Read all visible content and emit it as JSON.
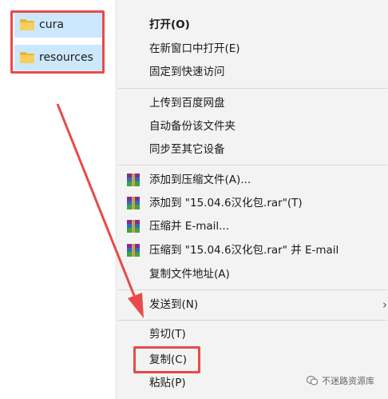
{
  "files": [
    {
      "name": "cura",
      "icon": "folder-icon"
    },
    {
      "name": "resources",
      "icon": "folder-icon"
    }
  ],
  "menu": {
    "items": [
      {
        "label": "打开(O)",
        "bold": true
      },
      {
        "label": "在新窗口中打开(E)"
      },
      {
        "label": "固定到快速访问"
      },
      {
        "label": "上传到百度网盘"
      },
      {
        "label": "自动备份该文件夹"
      },
      {
        "label": "同步至其它设备"
      },
      {
        "label": "添加到压缩文件(A)...",
        "icon": "winrar-icon"
      },
      {
        "label": "添加到 \"15.04.6汉化包.rar\"(T)",
        "icon": "winrar-icon"
      },
      {
        "label": "压缩并 E-mail...",
        "icon": "winrar-icon"
      },
      {
        "label": "压缩到 \"15.04.6汉化包.rar\" 并 E-mail",
        "icon": "winrar-icon"
      },
      {
        "label": "复制文件地址(A)"
      },
      {
        "label": "发送到(N)",
        "submenu": true
      },
      {
        "label": "剪切(T)"
      },
      {
        "label": "复制(C)"
      },
      {
        "label": "粘贴(P)"
      }
    ]
  },
  "watermark": {
    "text": "不迷路资源库"
  },
  "colors": {
    "highlight": "#e84a4a",
    "selection": "#cce8ff",
    "menu_bg": "#f3f3f3",
    "folder": "#f5c542"
  }
}
